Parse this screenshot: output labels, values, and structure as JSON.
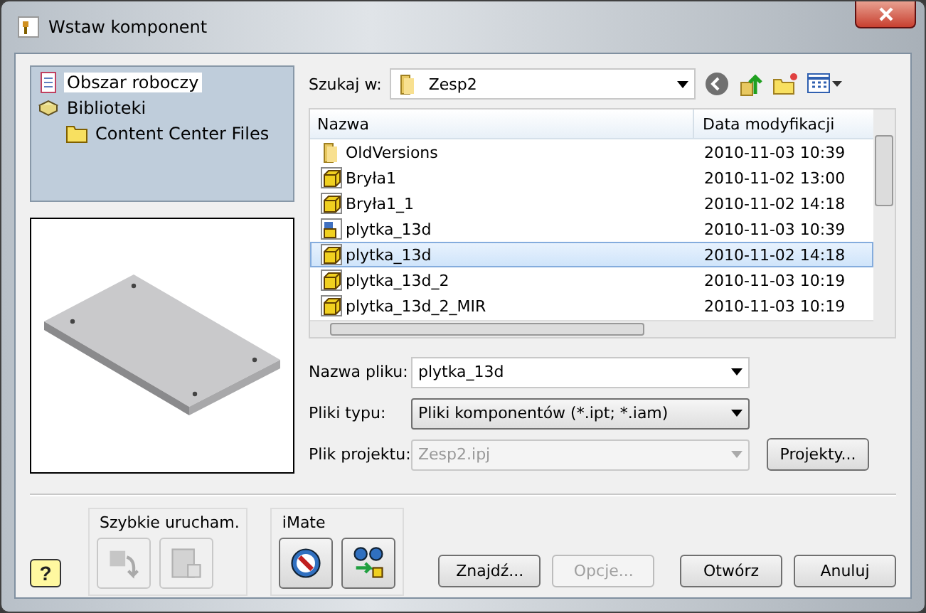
{
  "window": {
    "title": "Wstaw komponent"
  },
  "locations": [
    {
      "label": "Obszar roboczy",
      "kind": "workspace",
      "selected": true
    },
    {
      "label": "Biblioteki",
      "kind": "library",
      "selected": false,
      "children": [
        {
          "label": "Content Center Files",
          "kind": "folder",
          "selected": false
        }
      ]
    }
  ],
  "look_in": {
    "label": "Szukaj w:",
    "value": "Zesp2"
  },
  "file_list": {
    "columns": [
      "Nazwa",
      "Data modyfikacji"
    ],
    "rows": [
      {
        "name": "OldVersions",
        "date": "2010-11-03 10:39",
        "kind": "folder",
        "selected": false
      },
      {
        "name": "Bryła1",
        "date": "2010-11-02 13:00",
        "kind": "part",
        "selected": false
      },
      {
        "name": "Bryła1_1",
        "date": "2010-11-02 14:18",
        "kind": "part",
        "selected": false
      },
      {
        "name": "plytka_13d",
        "date": "2010-11-03 10:39",
        "kind": "assembly",
        "selected": false
      },
      {
        "name": "plytka_13d",
        "date": "2010-11-02 14:18",
        "kind": "part",
        "selected": true
      },
      {
        "name": "plytka_13d_2",
        "date": "2010-11-03 10:19",
        "kind": "part",
        "selected": false
      },
      {
        "name": "plytka_13d_2_MIR",
        "date": "2010-11-03 10:19",
        "kind": "part",
        "selected": false
      }
    ]
  },
  "fields": [
    {
      "label": "Nazwa pliku:",
      "value": "plytka_13d",
      "kind": "editable",
      "disabled": false
    },
    {
      "label": "Pliki typu:",
      "value": "Pliki komponentów (*.ipt; *.iam)",
      "kind": "dropdown",
      "disabled": false
    },
    {
      "label": "Plik projektu:",
      "value": "Zesp2.ipj",
      "kind": "dropdown",
      "disabled": true
    }
  ],
  "projects_button": "Projekty...",
  "help_button": "?",
  "groups": [
    {
      "title": "Szybkie urucham.",
      "buttons": [
        {
          "kind": "recent",
          "disabled": true
        },
        {
          "kind": "library",
          "disabled": true
        }
      ]
    },
    {
      "title": "iMate",
      "buttons": [
        {
          "kind": "imate",
          "disabled": false
        },
        {
          "kind": "interchange",
          "disabled": false
        }
      ]
    }
  ],
  "buttons": [
    {
      "label": "Znajdź...",
      "disabled": false
    },
    {
      "label": "Opcje...",
      "disabled": true
    }
  ],
  "dialog_buttons": [
    {
      "label": "Otwórz",
      "disabled": false
    },
    {
      "label": "Anuluj",
      "disabled": false
    }
  ]
}
